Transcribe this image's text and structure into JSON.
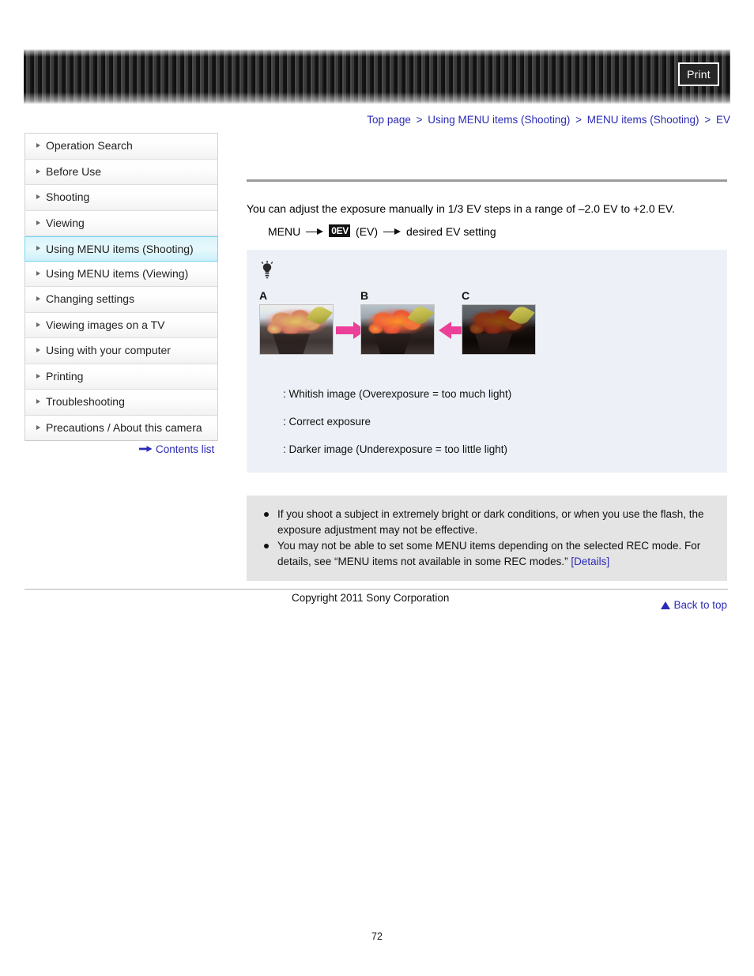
{
  "header": {
    "print_label": "Print",
    "banner_color": "#2b2b2b"
  },
  "breadcrumb": {
    "items": [
      {
        "label": "Top page"
      },
      {
        "label": "Using MENU items (Shooting)"
      },
      {
        "label": "MENU items (Shooting)"
      },
      {
        "label": "EV"
      }
    ],
    "separator": ">",
    "link_color": "#2b2bb5"
  },
  "sidebar": {
    "items": [
      {
        "label": "Operation Search",
        "selected": false
      },
      {
        "label": "Before Use",
        "selected": false
      },
      {
        "label": "Shooting",
        "selected": false
      },
      {
        "label": "Viewing",
        "selected": false
      },
      {
        "label": "Using MENU items (Shooting)",
        "selected": true
      },
      {
        "label": "Using MENU items (Viewing)",
        "selected": false
      },
      {
        "label": "Changing settings",
        "selected": false
      },
      {
        "label": "Viewing images on a TV",
        "selected": false
      },
      {
        "label": "Using with your computer",
        "selected": false
      },
      {
        "label": "Printing",
        "selected": false
      },
      {
        "label": "Troubleshooting",
        "selected": false
      },
      {
        "label": "Precautions / About this camera",
        "selected": false
      }
    ],
    "selected_bg": "#e0f6fc",
    "selected_border": "#76d6ee",
    "contents_list_label": "Contents list"
  },
  "main": {
    "lead": "You can adjust the exposure manually in 1/3 EV steps in a range of –2.0 EV to +2.0 EV.",
    "menu_path": {
      "start": "MENU",
      "icon_text": "0EV",
      "icon_caption": "(EV)",
      "end": "desired EV setting"
    },
    "tip_panel": {
      "bg_color": "#edf1f7",
      "photos": [
        {
          "letter": "A",
          "variant": "bright"
        },
        {
          "letter": "B",
          "variant": "normal"
        },
        {
          "letter": "C",
          "variant": "dark"
        }
      ],
      "arrow_color": "#ec3f98",
      "captions": [
        ": Whitish image (Overexposure = too much light)",
        ": Correct exposure",
        ": Darker image (Underexposure = too little light)"
      ]
    },
    "notes": {
      "bg_color": "#e4e4e4",
      "items": [
        {
          "text": "If you shoot a subject in extremely bright or dark conditions, or when you use the flash, the exposure adjustment may not be effective.",
          "link": ""
        },
        {
          "text": "You may not be able to set some MENU items depending on the selected REC mode. For details, see “MENU items not available in some REC modes.” ",
          "link": "[Details]"
        }
      ]
    }
  },
  "footer": {
    "back_to_top": "Back to top",
    "copyright": "Copyright 2011 Sony Corporation",
    "page_number": "72"
  }
}
